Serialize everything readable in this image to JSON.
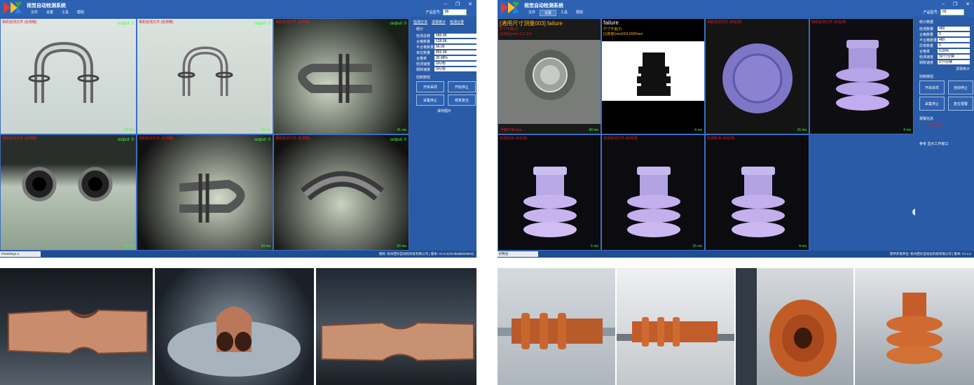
{
  "left_window": {
    "app_title": "视觉自动检测系统",
    "menu": [
      "文件",
      "设置",
      "工具",
      "帮助"
    ],
    "product_label": "产品型号:",
    "product_value": "86",
    "cameras": [
      {
        "caption": "相机检测文件 (名称略)",
        "output": "output: 0",
        "time": "53 ms"
      },
      {
        "caption": "相机检测文件 (名称略)",
        "output": "output: 0",
        "time": "33 ms"
      },
      {
        "caption": "相机检测文件 (名称略)",
        "output": "output: 0",
        "time": "41 ms"
      },
      {
        "caption": "相机检测文件 (名称略)",
        "output": "output: 0",
        "time": "30 ms"
      },
      {
        "caption": "相机检测文件 (名称略)",
        "output": "output: 0",
        "time": "33 ms"
      },
      {
        "caption": "相机检测文件 (名称略)",
        "output": "output: 0",
        "time": "33 ms"
      }
    ],
    "panel_links": [
      "检测方法",
      "清零统计",
      "检测记录"
    ],
    "stats_title": "统计",
    "stats": [
      {
        "k": "检测总数",
        "v": "586.08"
      },
      {
        "k": "合格数量",
        "v": "128.08"
      },
      {
        "k": "不合格数量",
        "v": "66.00"
      },
      {
        "k": "单位数量",
        "v": "855.08"
      },
      {
        "k": "合格率",
        "v": "35.88%"
      },
      {
        "k": "检测速度",
        "v": "0片/秒"
      },
      {
        "k": "剔除速度",
        "v": "0片/秒"
      }
    ],
    "control_title": "控制按钮",
    "buttons": [
      "开启采样",
      "开始停止",
      "采集停止",
      "修复复位"
    ],
    "bottom_label": "保存图片",
    "status_tab": "IOSetting1.4",
    "status_text": "版权: 杭州西尔自动化科技有限公司 | 版本: V1.0.1(V0.0build220810)"
  },
  "right_window": {
    "app_title": "视觉自动检测系统",
    "menu": [
      "文件",
      "设置",
      "工具",
      "帮助"
    ],
    "product_label": "产品型号:",
    "product_value": "03",
    "cam1_title": "[通用尺寸测量003] failure",
    "cam1_sub": "尺寸不良(1)",
    "cam1_sub2": "[1]内径(mm) 1.2, 0.0",
    "cam2_title": "failure",
    "cam2_sub": "尺寸不良(2)",
    "cam2_sub2": "[1]高度(mm)003.0000mm",
    "cameras": [
      {
        "caption": "相机检测文件",
        "time": "40 ms",
        "left": "平面不良 lens"
      },
      {
        "caption": "相机检测文件",
        "time": "4 ms",
        "left": ""
      },
      {
        "caption": "相机检测文件 (未检测)",
        "time": "15 ms",
        "left": ""
      },
      {
        "caption": "相机检测文件 (未检测)",
        "time": "4 ms",
        "left": ""
      },
      {
        "caption": "检测检测 (未检测)",
        "time": "5 ms",
        "left": ""
      },
      {
        "caption": "检测检测文件 (未检测)",
        "time": "15 ms",
        "left": ""
      },
      {
        "caption": "检测检测 (未检测)",
        "time": "4 ms",
        "left": ""
      }
    ],
    "stats_title": "统计数据",
    "stats": [
      {
        "k": "检测数量",
        "v": "480"
      },
      {
        "k": "合格数量",
        "v": "0"
      },
      {
        "k": "不合格数量",
        "v": "480"
      },
      {
        "k": "异常数量",
        "v": "0"
      },
      {
        "k": "合格率",
        "v": "0.00%"
      },
      {
        "k": "检测速度",
        "v": "30个/分钟"
      },
      {
        "k": "剔除速度",
        "v": "0个/分钟"
      }
    ],
    "reset_label": "清零统计",
    "control_title": "控制按钮",
    "buttons": [
      "开启采样",
      "自动停止",
      "采集停止",
      "复位报警"
    ],
    "alarm_title": "报警信息",
    "alarm_text": "检测失败",
    "bottom_link": "参考 显示工作窗口",
    "status_tab": "控制台",
    "status_text": "软件开发单位: 杭州西尔自动化科技有限公司 | 版本: V1.1.1"
  },
  "colors": {
    "window_blue": "#2a5ba6",
    "caption_red": "#e02020",
    "ok_green": "#39ff39",
    "cell_border": "#3a6fc0"
  }
}
